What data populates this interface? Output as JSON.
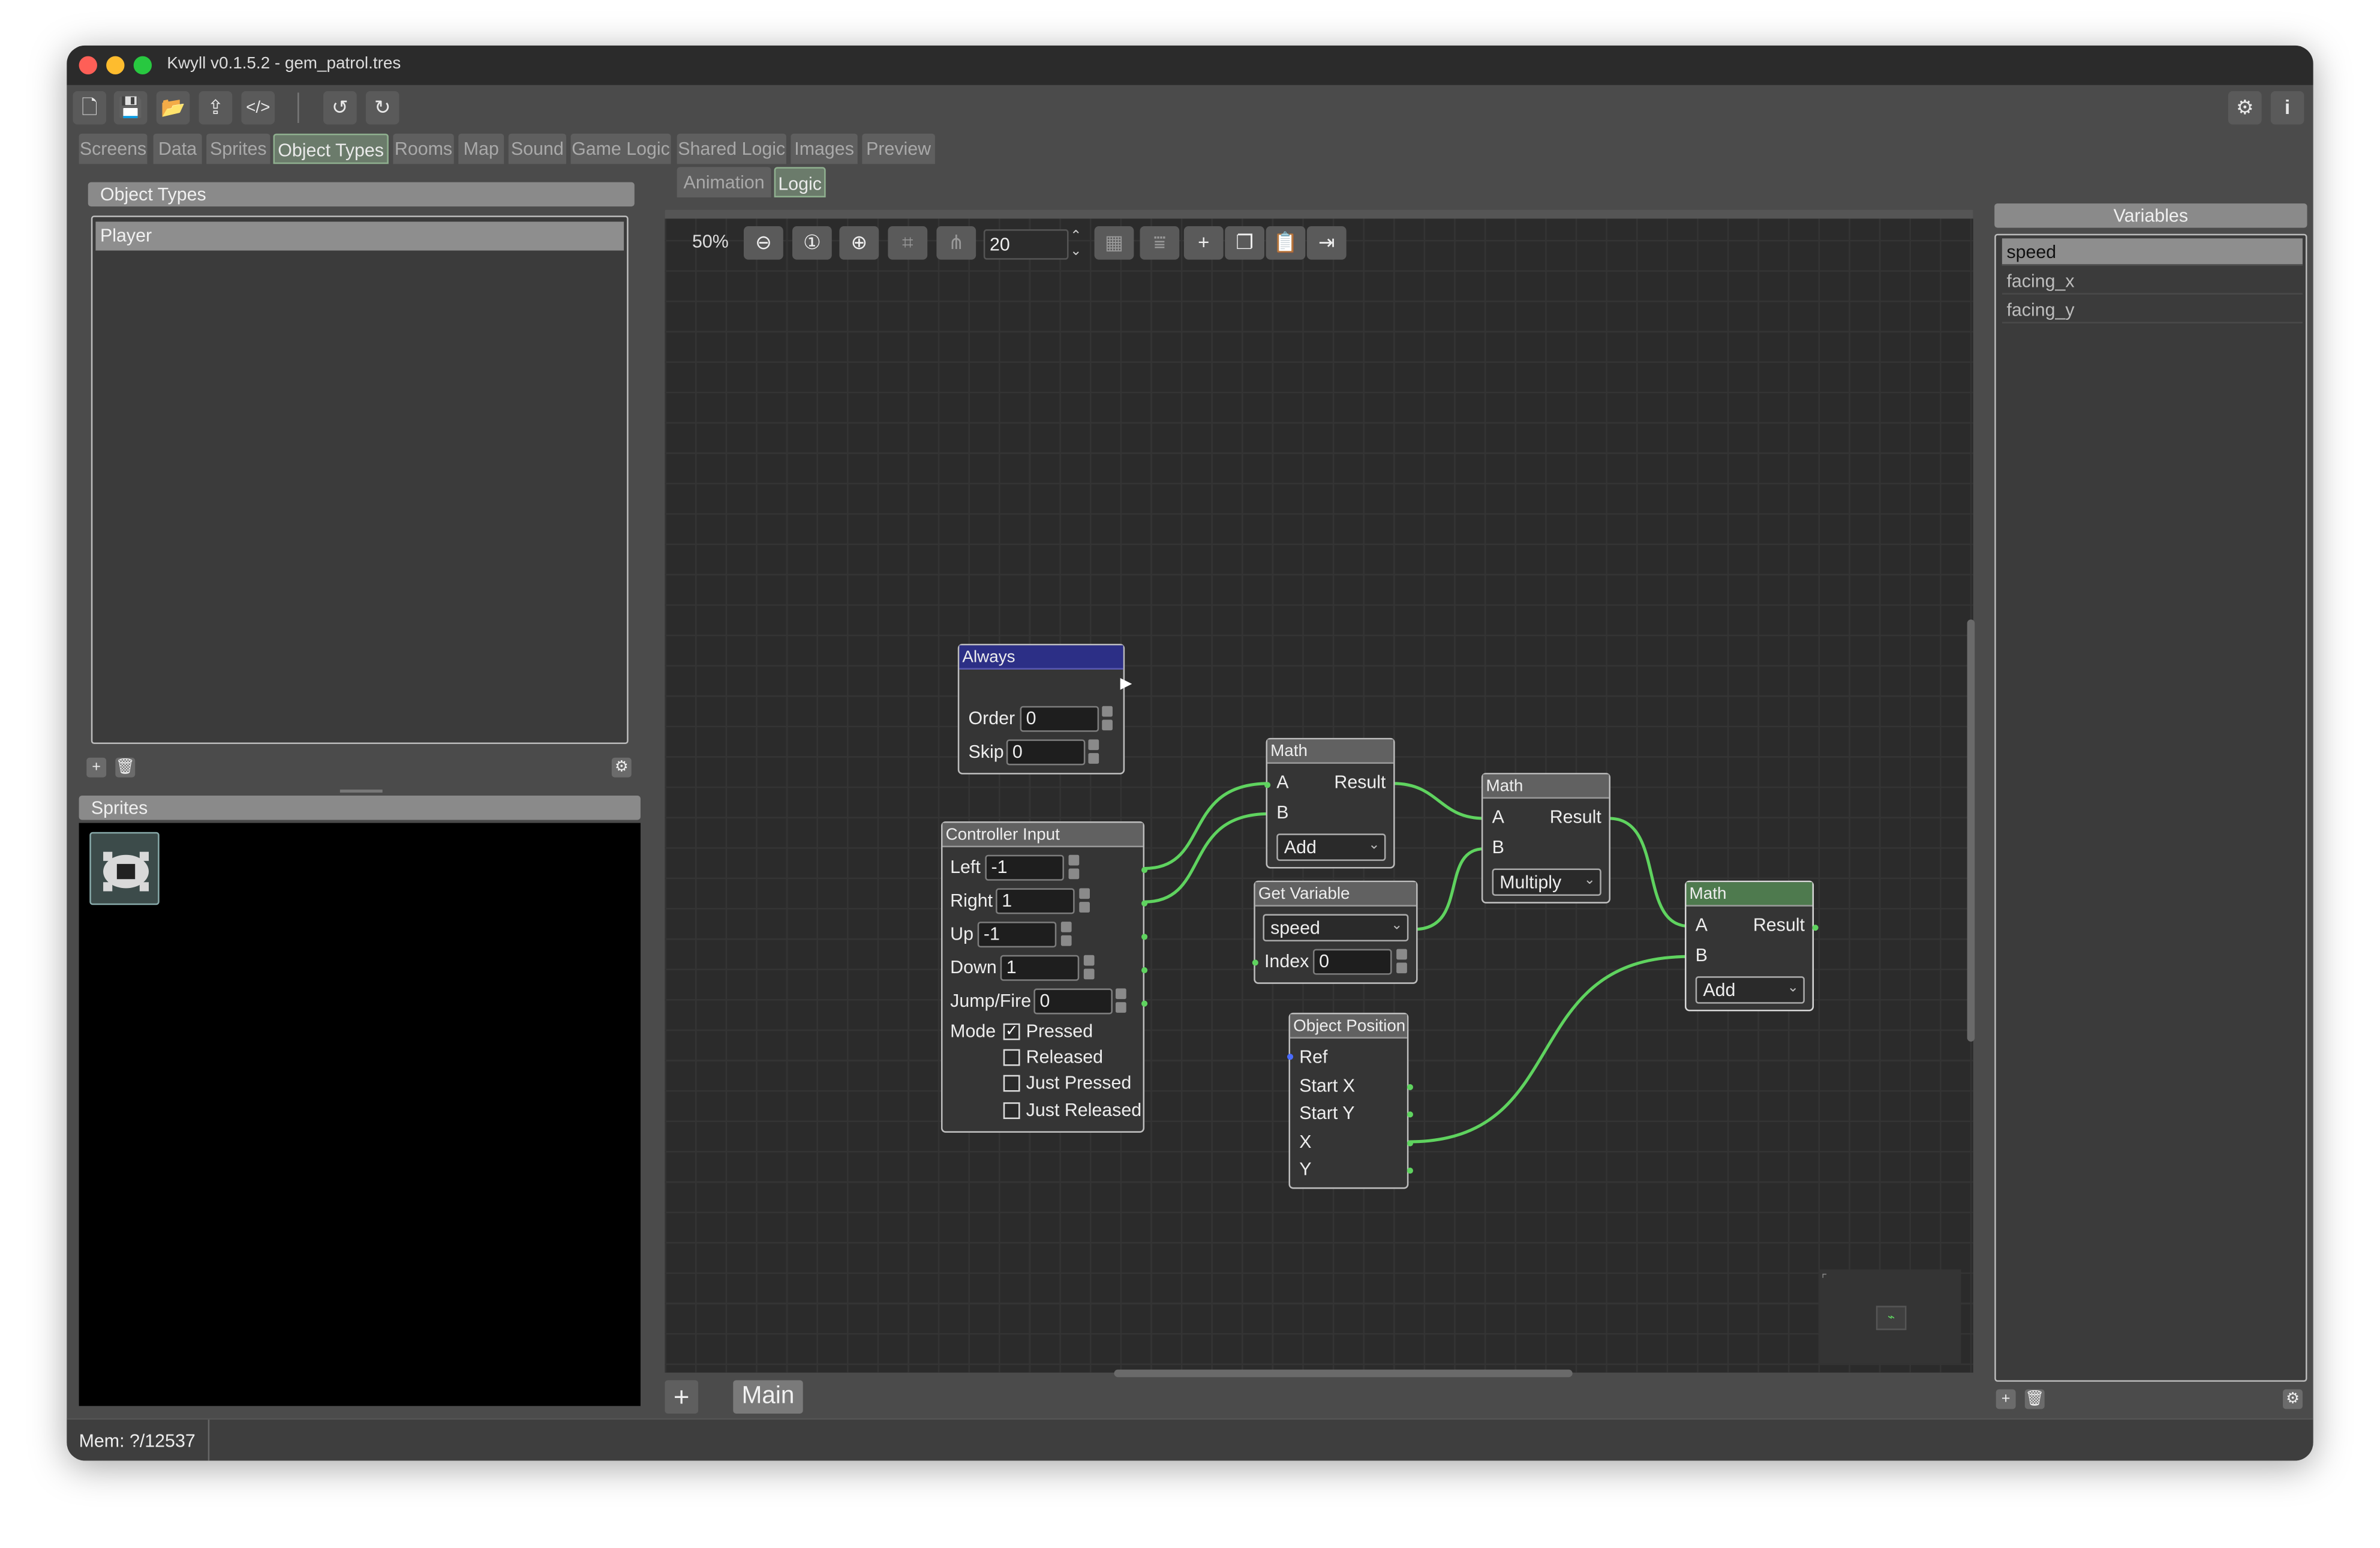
{
  "window": {
    "title": "Kwyll v0.1.5.2 - gem_patrol.tres"
  },
  "colors": {
    "accent_green": "#5fd35f",
    "always_header": "#2c2f86",
    "math_active_header": "#4e7a4e",
    "canvas_bg": "#2b2b2b"
  },
  "toolbar": {
    "left_icons": [
      "new-file-icon",
      "save-icon",
      "open-folder-icon",
      "export-icon",
      "code-icon",
      "undo-icon",
      "redo-icon"
    ],
    "right_icons": [
      "settings-icon",
      "info-icon"
    ]
  },
  "main_tabs": [
    "Screens",
    "Data",
    "Sprites",
    "Object Types",
    "Rooms",
    "Map",
    "Sound",
    "Game Logic",
    "Shared Logic",
    "Images",
    "Preview"
  ],
  "active_main_tab": "Object Types",
  "sub_tabs": [
    "Animation",
    "Logic"
  ],
  "active_sub_tab": "Logic",
  "object_types": {
    "header": "Object Types",
    "items": [
      "Player"
    ],
    "selected": "Player"
  },
  "sprites": {
    "header": "Sprites"
  },
  "graph_toolbar": {
    "zoom": "50%",
    "snap_value": "20"
  },
  "nodes": {
    "always": {
      "title": "Always",
      "order_label": "Order",
      "order_value": "0",
      "skip_label": "Skip",
      "skip_value": "0"
    },
    "controller": {
      "title": "Controller Input",
      "fields": [
        {
          "label": "Left",
          "value": "-1"
        },
        {
          "label": "Right",
          "value": "1"
        },
        {
          "label": "Up",
          "value": "-1"
        },
        {
          "label": "Down",
          "value": "1"
        },
        {
          "label": "Jump/Fire",
          "value": "0"
        }
      ],
      "mode_label": "Mode",
      "modes": [
        {
          "label": "Pressed",
          "checked": true
        },
        {
          "label": "Released",
          "checked": false
        },
        {
          "label": "Just Pressed",
          "checked": false
        },
        {
          "label": "Just Released",
          "checked": false
        }
      ]
    },
    "math1": {
      "title": "Math",
      "a": "A",
      "b": "B",
      "result": "Result",
      "op": "Add"
    },
    "math2": {
      "title": "Math",
      "a": "A",
      "b": "B",
      "result": "Result",
      "op": "Multiply"
    },
    "math3": {
      "title": "Math",
      "a": "A",
      "b": "B",
      "result": "Result",
      "op": "Add"
    },
    "get_variable": {
      "title": "Get Variable",
      "variable": "speed",
      "index_label": "Index",
      "index_value": "0"
    },
    "object_position": {
      "title": "Object Position",
      "outputs": [
        "Ref",
        "Start X",
        "Start Y",
        "X",
        "Y"
      ]
    }
  },
  "graph_tabs": {
    "add_label": "+",
    "current": "Main"
  },
  "variables": {
    "header": "Variables",
    "items": [
      "speed",
      "facing_x",
      "facing_y"
    ],
    "selected": "speed"
  },
  "status": {
    "memory": "Mem: ?/12537"
  }
}
